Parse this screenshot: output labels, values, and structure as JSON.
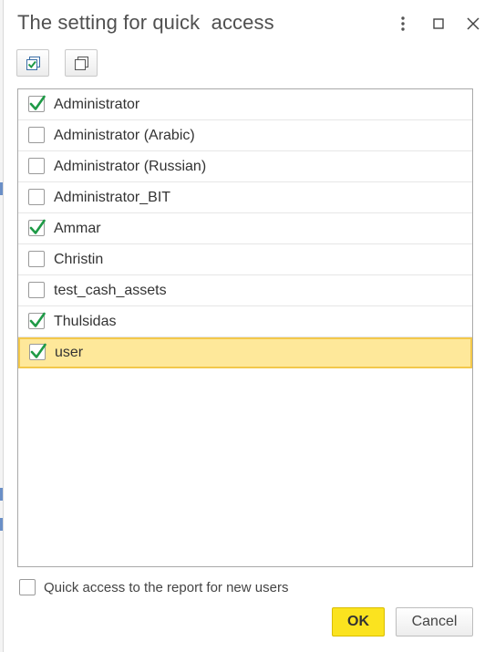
{
  "window": {
    "title": "The setting for quick  access",
    "more_icon": "vertical-ellipsis",
    "maximize_icon": "square",
    "close_icon": "x"
  },
  "toolbar": {
    "check_all_icon": "check-all-icon",
    "uncheck_all_icon": "uncheck-all-icon"
  },
  "users": [
    {
      "name": "Administrator",
      "checked": true
    },
    {
      "name": "Administrator (Arabic)",
      "checked": false
    },
    {
      "name": "Administrator (Russian)",
      "checked": false
    },
    {
      "name": "Administrator_BIT",
      "checked": false
    },
    {
      "name": "Ammar",
      "checked": true
    },
    {
      "name": "Christin",
      "checked": false
    },
    {
      "name": "test_cash_assets",
      "checked": false
    },
    {
      "name": "Thulsidas",
      "checked": true
    },
    {
      "name": "user",
      "checked": true,
      "selected": true
    }
  ],
  "footer": {
    "new_users_label": "Quick access to the report for new users",
    "new_users_checked": false,
    "ok_label": "OK",
    "cancel_label": "Cancel"
  },
  "colors": {
    "check_green": "#1e9a46",
    "selected_row_bg": "#fee89a",
    "selected_row_border": "#f3c84b",
    "ok_button_bg": "#fbe31f"
  }
}
